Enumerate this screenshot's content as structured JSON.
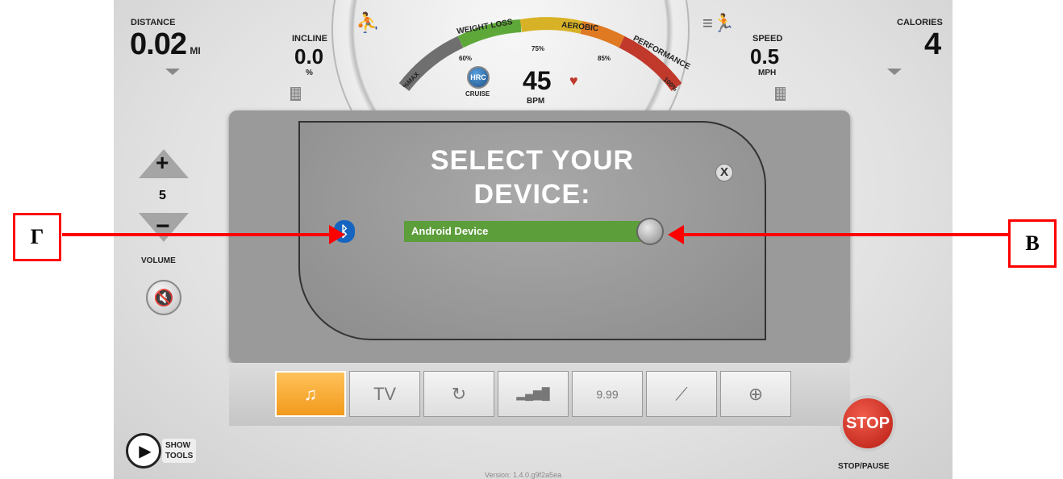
{
  "stats": {
    "distance": {
      "label": "DISTANCE",
      "value": "0.02",
      "unit": "MI"
    },
    "incline": {
      "label": "INCLINE",
      "value": "0.0",
      "unit": "%"
    },
    "speed": {
      "label": "SPEED",
      "value": "0.5",
      "unit": "MPH"
    },
    "calories": {
      "label": "CALORIES",
      "value": "4"
    }
  },
  "gauge": {
    "zones": [
      "WEIGHT LOSS",
      "AEROBIC",
      "PERFORMANCE"
    ],
    "ticks": [
      "%MAX",
      "60%",
      "75%",
      "85%",
      "100%"
    ],
    "hrc_label": "HRC",
    "cruise_label": "CRUISE",
    "bpm_value": "45",
    "bpm_label": "BPM",
    "colors": {
      "gray": "#777777",
      "green": "#5ea83a",
      "yellow": "#d8b226",
      "orange": "#df7a22",
      "red": "#c0392b"
    }
  },
  "volume": {
    "plus": "+",
    "level": "5",
    "minus": "−",
    "label": "VOLUME"
  },
  "dialog": {
    "title": "SELECT YOUR\nDEVICE:",
    "close": "X",
    "device": "Android Device",
    "bluetooth_icon": "bluetooth-icon"
  },
  "tray": {
    "items": [
      {
        "name": "phone-music-icon",
        "glyph": "♫",
        "active": true
      },
      {
        "name": "tv-icon",
        "glyph": "TV",
        "active": false
      },
      {
        "name": "replay-icon",
        "glyph": "↻",
        "active": false
      },
      {
        "name": "equalizer-icon",
        "glyph": "▂▄▆█",
        "active": false
      },
      {
        "name": "price-display-icon",
        "glyph": "9.99",
        "active": false
      },
      {
        "name": "route-icon",
        "glyph": "⟋",
        "active": false
      },
      {
        "name": "globe-www-icon",
        "glyph": "⊕",
        "active": false
      }
    ]
  },
  "show_tools": "SHOW\nTOOLS",
  "stop": {
    "button": "STOP",
    "label": "STOP/PAUSE"
  },
  "version": "Version: 1.4.0.g9f2a5ea",
  "annotations": {
    "left": "Г",
    "right": "В",
    "color": "#ff0000"
  }
}
